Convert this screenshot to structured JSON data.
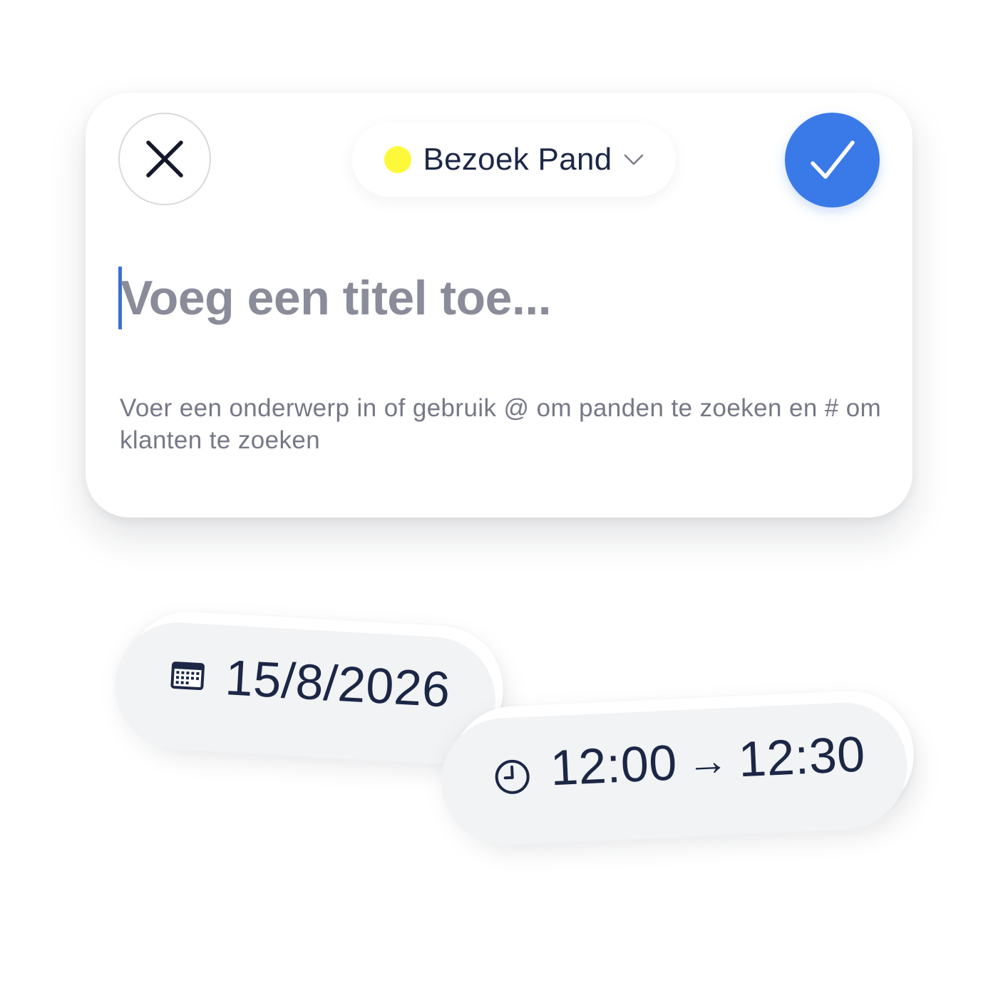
{
  "card": {
    "close_icon": "close-icon",
    "confirm_icon": "checkmark-icon",
    "type_selector": {
      "label": "Bezoek Pand",
      "dot_color": "#fdf93a",
      "chevron_icon": "chevron-down-icon"
    },
    "title_input": {
      "placeholder": "Voeg een titel toe..."
    },
    "hint_text": "Voer een onderwerp in of gebruik @ om panden te zoeken en # om klanten te zoeken"
  },
  "date_pill": {
    "icon": "calendar-icon",
    "value": "15/8/2026"
  },
  "time_pill": {
    "icon": "clock-icon",
    "start": "12:00",
    "arrow": "→",
    "end": "12:30"
  },
  "colors": {
    "accent": "#3a7ae8",
    "text": "#1c2746",
    "placeholder": "#8a8c99",
    "hint": "#767887"
  }
}
